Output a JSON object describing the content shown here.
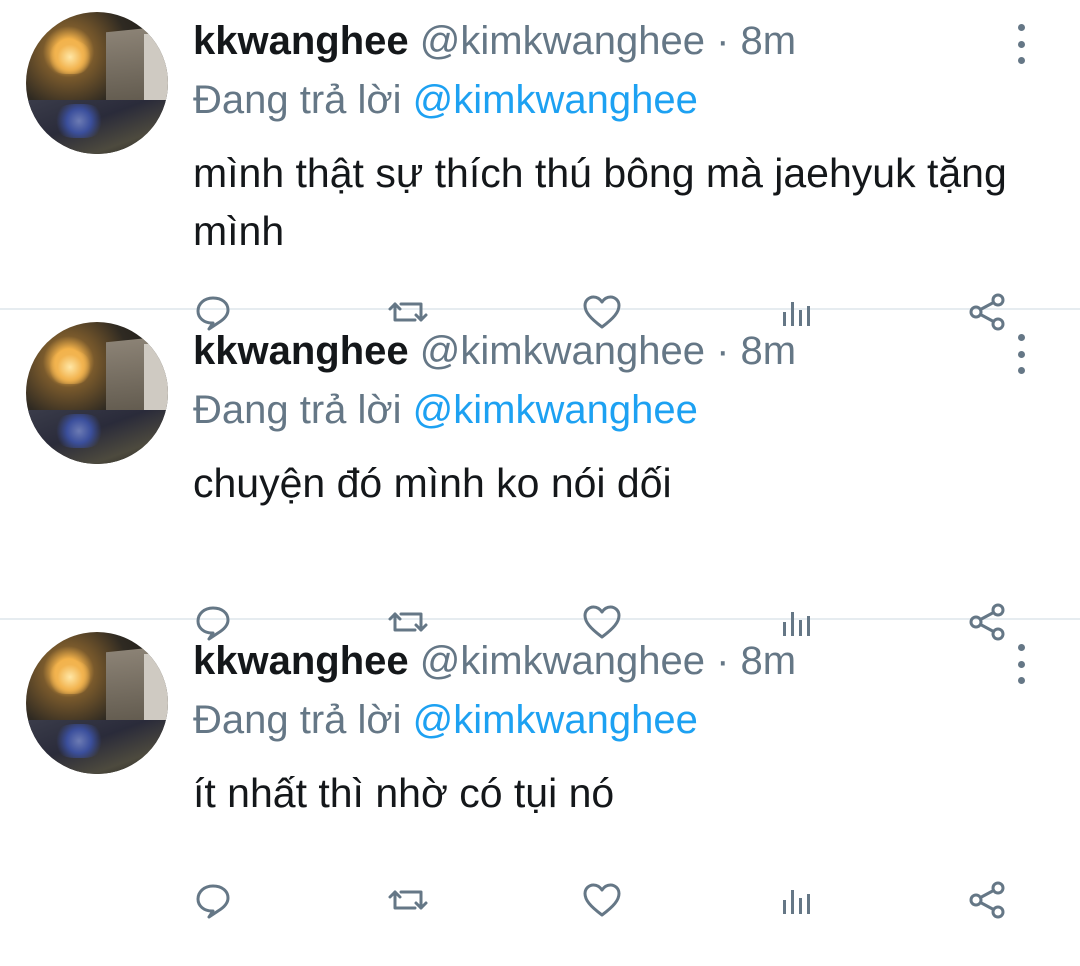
{
  "tweets": [
    {
      "name": "kkwanghee",
      "handle": "@kimkwanghee",
      "dot": "·",
      "time": "8m",
      "replying_prefix": "Đang trả lời",
      "replying_to": "@kimkwanghee",
      "text": "mình thật sự thích thú bông mà jaehyuk tặng mình"
    },
    {
      "name": "kkwanghee",
      "handle": "@kimkwanghee",
      "dot": "·",
      "time": "8m",
      "replying_prefix": "Đang trả lời",
      "replying_to": "@kimkwanghee",
      "text": "chuyện đó mình ko nói dối"
    },
    {
      "name": "kkwanghee",
      "handle": "@kimkwanghee",
      "dot": "·",
      "time": "8m",
      "replying_prefix": "Đang trả lời",
      "replying_to": "@kimkwanghee",
      "text": "ít nhất thì nhờ có tụi nó"
    }
  ],
  "icons": [
    "reply-icon",
    "retweet-icon",
    "like-icon",
    "analytics-icon",
    "share-icon",
    "more-options-icon"
  ],
  "colors": {
    "accent": "#1da1f2",
    "secondary_text": "#657786",
    "primary_text": "#14171a",
    "divider": "#e6ecf0"
  }
}
